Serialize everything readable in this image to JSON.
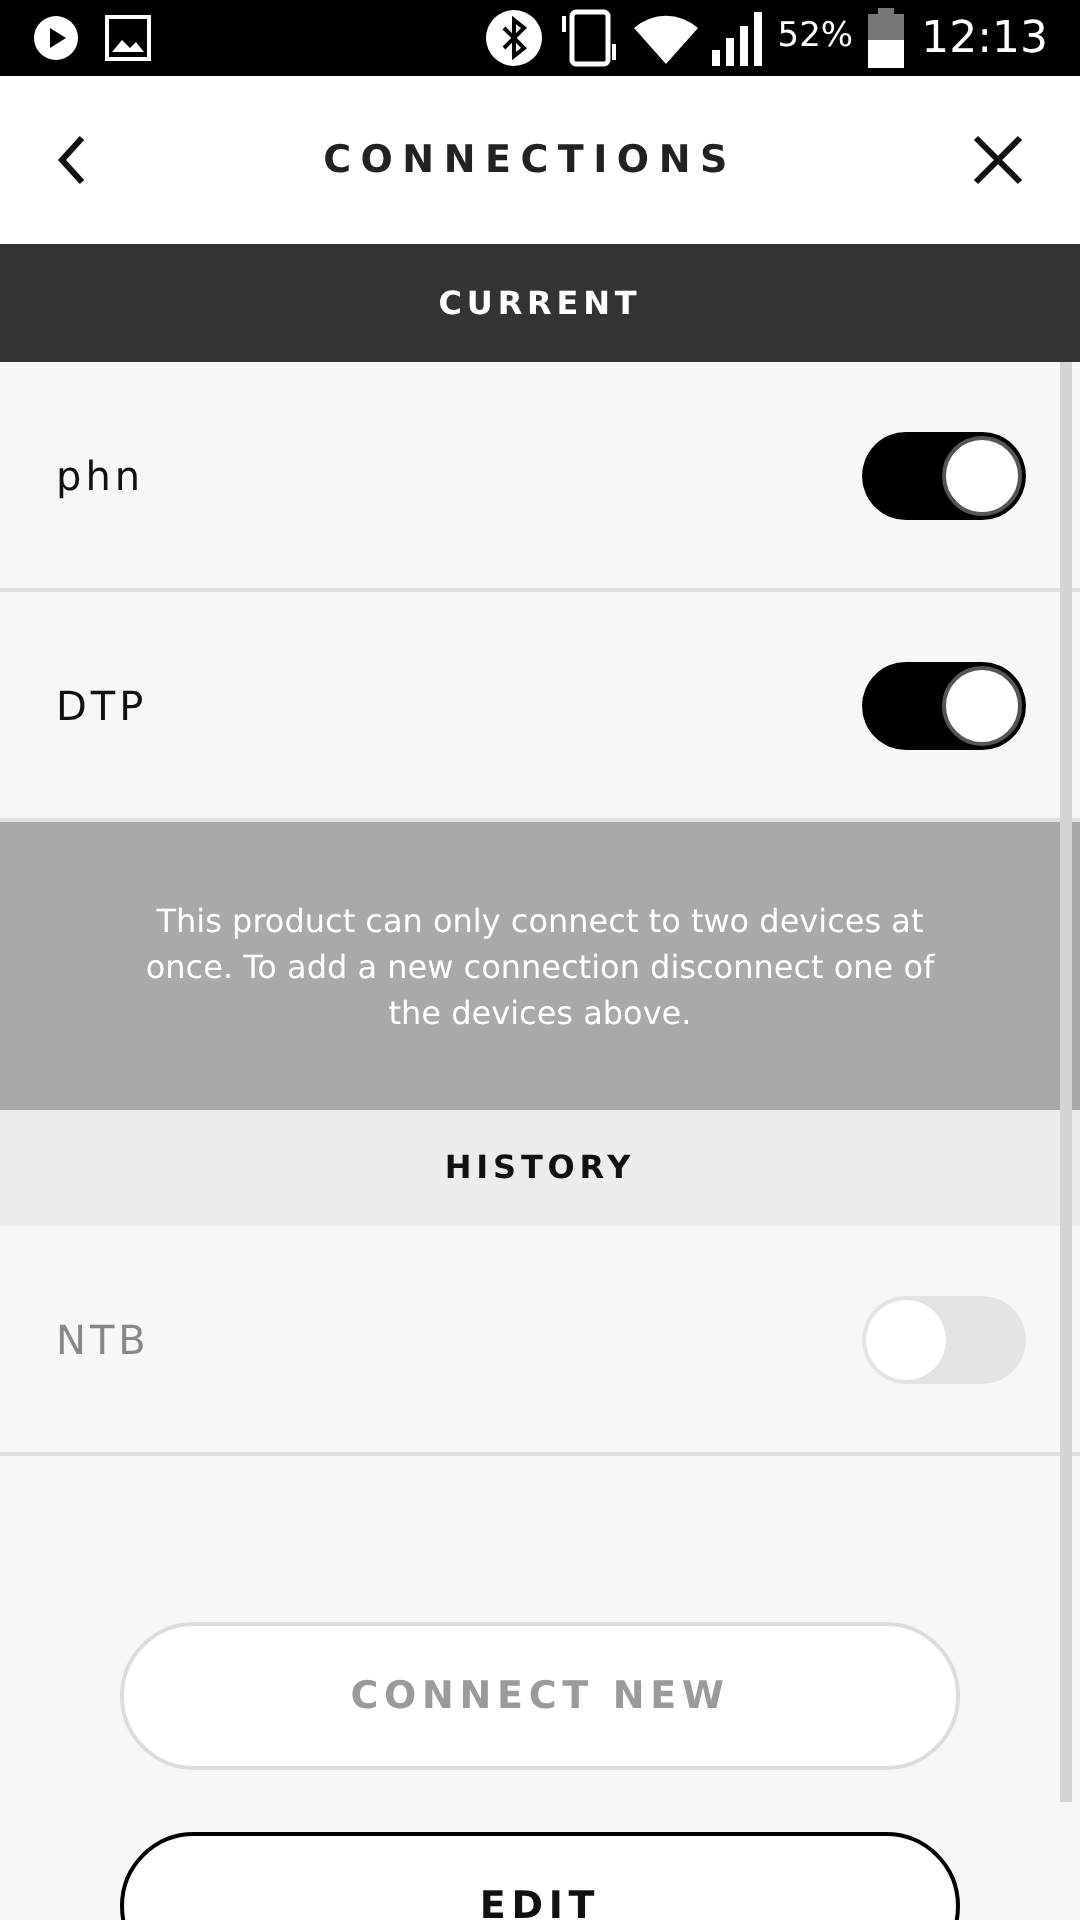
{
  "status_bar": {
    "battery": "52%",
    "time": "12:13"
  },
  "header": {
    "title": "CONNECTIONS"
  },
  "current": {
    "heading": "CURRENT",
    "devices": [
      {
        "name": "phn",
        "on": true
      },
      {
        "name": "DTP",
        "on": true
      }
    ],
    "notice": "This product can only connect to two devices at once. To add a new connection disconnect one of the devices above."
  },
  "history": {
    "heading": "HISTORY",
    "devices": [
      {
        "name": "NTB",
        "on": false
      }
    ]
  },
  "buttons": [
    {
      "label": "CONNECT NEW",
      "disabled": true
    },
    {
      "label": "EDIT",
      "disabled": false
    }
  ]
}
